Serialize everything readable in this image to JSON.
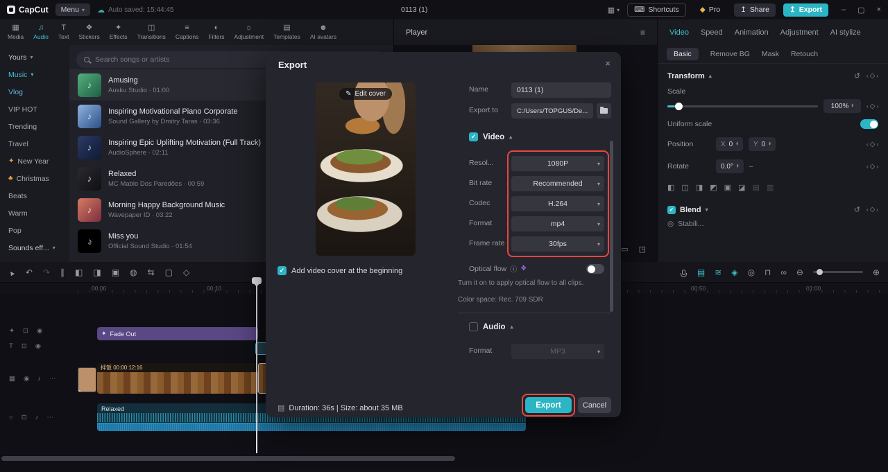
{
  "colors": {
    "accent": "#2cb5c5",
    "highlight": "#e8473c"
  },
  "titlebar": {
    "app_name": "CapCut",
    "menu": "Menu",
    "autosave": "Auto saved: 15:44:45",
    "project_title": "0113 (1)",
    "shortcuts": "Shortcuts",
    "pro": "Pro",
    "share": "Share",
    "export": "Export"
  },
  "media_tabs": [
    {
      "label": "Media"
    },
    {
      "label": "Audio"
    },
    {
      "label": "Text"
    },
    {
      "label": "Stickers"
    },
    {
      "label": "Effects"
    },
    {
      "label": "Transitions"
    },
    {
      "label": "Captions"
    },
    {
      "label": "Filters"
    },
    {
      "label": "Adjustment"
    },
    {
      "label": "Templates"
    },
    {
      "label": "AI avatars"
    }
  ],
  "sidebar": {
    "yours": "Yours",
    "music": "Music",
    "items": [
      "Vlog",
      "VIP HOT",
      "Trending",
      "Travel",
      "New Year",
      "Christmas",
      "Beats",
      "Warm",
      "Pop"
    ],
    "sounds": "Sounds eff..."
  },
  "music_panel": {
    "search_placeholder": "Search songs or artists",
    "songs": [
      {
        "title": "Amusing",
        "subtitle": "Ausku Studio · 01:00"
      },
      {
        "title": "Inspiring Motivational Piano Corporate",
        "subtitle": "Sound Gallery by Dmitry Taras · 03:36"
      },
      {
        "title": "Inspiring Epic Uplifting Motivation (Full Track)",
        "subtitle": "AudioSphere · 02:11"
      },
      {
        "title": "Relaxed",
        "subtitle": "MC Mablo Dos Paredões · 00:59"
      },
      {
        "title": "Morning Happy Background Music",
        "subtitle": "Wavepaper ID · 03:22"
      },
      {
        "title": "Miss you",
        "subtitle": "Official Sound Studio · 01:54"
      }
    ]
  },
  "player": {
    "title": "Player"
  },
  "props": {
    "tabs": [
      {
        "label": "Video"
      },
      {
        "label": "Speed"
      },
      {
        "label": "Animation"
      },
      {
        "label": "Adjustment"
      },
      {
        "label": "AI stylize"
      }
    ],
    "subtabs": [
      {
        "label": "Basic"
      },
      {
        "label": "Remove BG"
      },
      {
        "label": "Mask"
      },
      {
        "label": "Retouch"
      }
    ],
    "transform_title": "Transform",
    "scale_label": "Scale",
    "scale_value": "100%",
    "uniform_label": "Uniform scale",
    "position_label": "Position",
    "x_label": "X",
    "x_value": "0",
    "y_label": "Y",
    "y_value": "0",
    "rotate_label": "Rotate",
    "rotate_value": "0.0°",
    "blend_title": "Blend",
    "stabilize_label": "Stabili..."
  },
  "export_dialog": {
    "title": "Export",
    "edit_cover": "Edit cover",
    "add_cover": "Add video cover at the beginning",
    "name_label": "Name",
    "name_value": "0113 (1)",
    "export_to_label": "Export to",
    "export_to_value": "C:/Users/TOPGUS/De...",
    "video_section": "Video",
    "video_fields": [
      {
        "label": "Resol...",
        "value": "1080P"
      },
      {
        "label": "Bit rate",
        "value": "Recommended"
      },
      {
        "label": "Codec",
        "value": "H.264"
      },
      {
        "label": "Format",
        "value": "mp4"
      },
      {
        "label": "Frame rate",
        "value": "30fps"
      }
    ],
    "optical_flow_label": "Optical flow",
    "optical_flow_hint": "Turn it on to apply optical flow to all clips.",
    "color_space": "Color space: Rec. 709 SDR",
    "audio_section": "Audio",
    "audio_format_label": "Format",
    "audio_format_value": "MP3",
    "footer_info": "Duration: 36s | Size: about 35 MB",
    "export_button": "Export",
    "cancel_button": "Cancel"
  },
  "timeline": {
    "ruler": [
      "00:00",
      "00:10",
      "00:50",
      "01:00"
    ],
    "fade_out_clip": "Fade Out",
    "video_clip_label": "拌饭 00:00:12:16",
    "audio_clip_label": "Relaxed"
  }
}
